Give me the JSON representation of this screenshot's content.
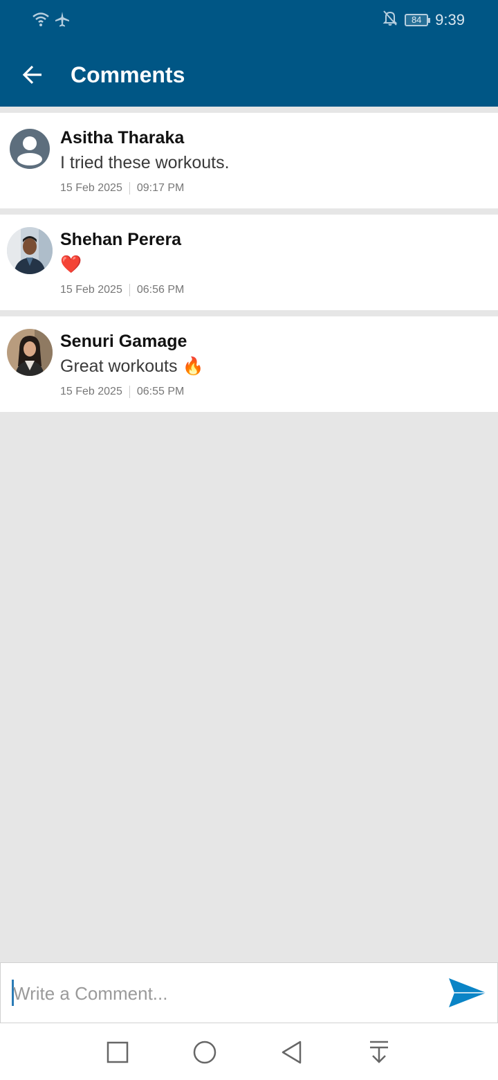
{
  "status_bar": {
    "time": "9:39",
    "battery": "84",
    "icons": [
      "wifi-icon",
      "airplane-icon",
      "notifications-off-icon",
      "battery-icon"
    ]
  },
  "header": {
    "title": "Comments",
    "back_icon": "arrow-left-icon",
    "background": "#005685"
  },
  "comments": [
    {
      "name": "Asitha Tharaka",
      "text": "I tried these workouts.",
      "date": "15 Feb 2025",
      "time": "09:17 PM",
      "avatar": "default-user-avatar"
    },
    {
      "name": "Shehan Perera",
      "text": "❤️",
      "date": "15 Feb 2025",
      "time": "06:56 PM",
      "avatar": "photo-avatar"
    },
    {
      "name": "Senuri Gamage",
      "text": "Great workouts 🔥",
      "date": "15 Feb 2025",
      "time": "06:55 PM",
      "avatar": "photo-avatar"
    }
  ],
  "composer": {
    "placeholder": "Write a Comment...",
    "value": "",
    "send_icon": "send-icon",
    "accent": "#0a84c6"
  },
  "nav_bar": {
    "buttons": [
      "recents-square-icon",
      "home-circle-icon",
      "back-triangle-icon",
      "notification-shade-icon"
    ]
  }
}
